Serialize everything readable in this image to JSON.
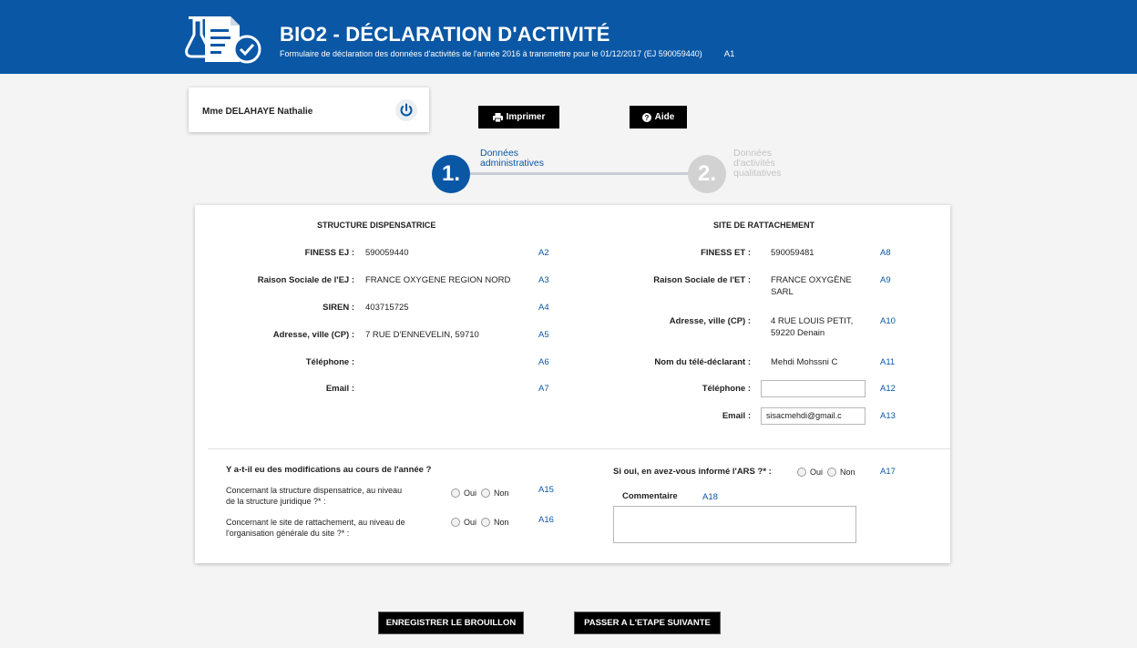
{
  "header": {
    "title": "BIO2 - DÉCLARATION D'ACTIVITÉ",
    "subtitle": "Formulaire de déclaration des données d'activités de l'année 2016 à transmettre pour le 01/12/2017 (EJ 590059440)",
    "code": "A1",
    "color": "#0a57a5"
  },
  "user": {
    "name": "Mme DELAHAYE Nathalie",
    "icon": "power-icon"
  },
  "toolbar": {
    "print_label": "Imprimer",
    "print_icon": "print-icon",
    "help_label": "Aide",
    "help_icon": "help-icon"
  },
  "stepper": {
    "steps": [
      {
        "number": "1.",
        "label_line1": "Données",
        "label_line2": "administratives",
        "active": true
      },
      {
        "number": "2.",
        "label_line1": "Données",
        "label_line2": "d'activités",
        "label_line3": "qualitatives",
        "active": false
      }
    ]
  },
  "structure": {
    "title": "STRUCTURE DISPENSATRICE",
    "rows": [
      {
        "label": "FINESS EJ :",
        "value": "590059440",
        "code": "A2"
      },
      {
        "label": "Raison Sociale de l'EJ :",
        "value": "FRANCE OXYGENE REGION NORD",
        "code": "A3"
      },
      {
        "label": "SIREN :",
        "value": "403715725",
        "code": "A4"
      },
      {
        "label": "Adresse, ville (CP) :",
        "value": "7 RUE D'ENNEVELIN, 59710",
        "code": "A5"
      },
      {
        "label": "Téléphone :",
        "value": "",
        "code": "A6"
      },
      {
        "label": "Email :",
        "value": "",
        "code": "A7"
      }
    ]
  },
  "site": {
    "title": "SITE DE RATTACHEMENT",
    "finess": {
      "label": "FINESS ET :",
      "value": "590059481",
      "code": "A8"
    },
    "raison": {
      "label": "Raison Sociale de l'ET :",
      "value_line1": "FRANCE OXYGÈNE",
      "value_line2": "SARL",
      "code": "A9"
    },
    "adresse": {
      "label": "Adresse, ville (CP) :",
      "value_line1": "4 RUE LOUIS PETIT,",
      "value_line2": "59220 Denain",
      "code": "A10"
    },
    "declarant": {
      "label": "Nom du télé-déclarant :",
      "value": "Mehdi Mohssni C",
      "code": "A11"
    },
    "telephone": {
      "label": "Téléphone :",
      "value": "",
      "code": "A12"
    },
    "email": {
      "label": "Email :",
      "value": "sisacmehdi@gmail.c",
      "code": "A13"
    }
  },
  "modifications": {
    "question": "Y a-t-il eu des modifications au cours de l'année ?",
    "q1_line1": "Concernant la structure dispensatrice, au niveau",
    "q1_line2": "de la structure juridique ?* :",
    "q1_code": "A15",
    "q2_line1": "Concernant le site de rattachement, au niveau de",
    "q2_line2": "l'organisation générale du site ?* :",
    "q2_code": "A16",
    "oui": "Oui",
    "non": "Non"
  },
  "ars": {
    "question": "Si oui, en avez-vous informé l'ARS ?* :",
    "code": "A17",
    "comment_label": "Commentaire",
    "comment_code": "A18",
    "comment_value": ""
  },
  "footer": {
    "save_label": "ENREGISTRER LE BROUILLON",
    "next_label": "PASSER A L'ETAPE SUIVANTE"
  }
}
